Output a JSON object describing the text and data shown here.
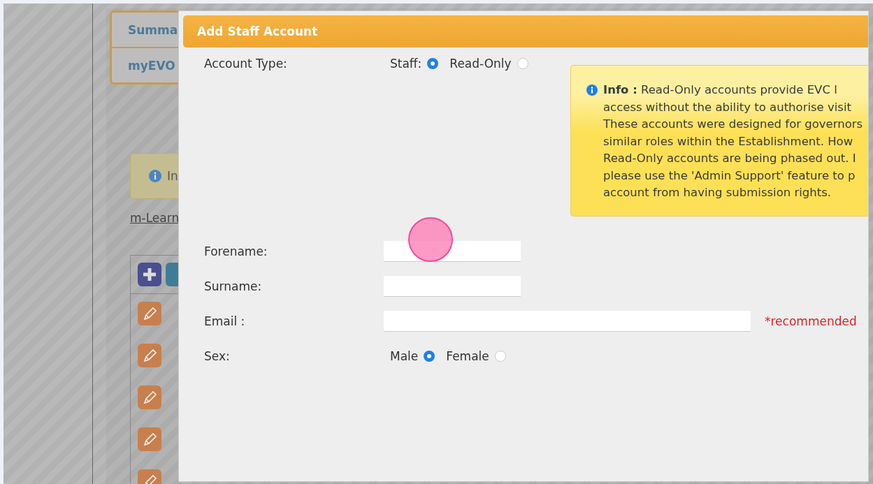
{
  "background": {
    "tabs": [
      {
        "label": "Summa"
      },
      {
        "label": "myEVO"
      }
    ],
    "info_label": "In",
    "link": "m-Learn"
  },
  "dialog": {
    "title": "Add Staff Account",
    "account_type": {
      "label": "Account Type:",
      "options": [
        {
          "label": "Staff:",
          "selected": true
        },
        {
          "label": "Read-Only",
          "selected": false
        }
      ]
    },
    "info": {
      "lines": [
        "**Info :** Read-Only accounts provide EVC l",
        "access without the ability to authorise visit",
        "These accounts were designed for governors",
        "similar roles within the Establishment. How",
        "Read-Only accounts are being phased out. I",
        "please use the 'Admin Support' feature to p",
        "account from having submission rights."
      ]
    },
    "fields": [
      {
        "label": "Forename:",
        "kind": "short"
      },
      {
        "label": "Surname:",
        "kind": "short"
      },
      {
        "label": "Email :",
        "kind": "long",
        "note": "*recommended"
      }
    ],
    "sex": {
      "label": "Sex:",
      "options": [
        {
          "label": "Male",
          "selected": true
        },
        {
          "label": "Female",
          "selected": false
        }
      ]
    }
  }
}
